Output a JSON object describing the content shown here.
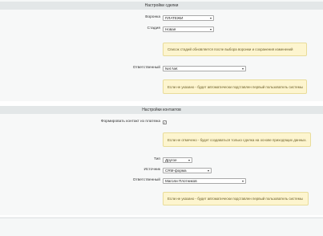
{
  "deal_settings": {
    "title": "Настройки сделки",
    "funnel": {
      "label": "Воронка",
      "value": "ПЛАТЕЖИ"
    },
    "stage": {
      "label": "Стадия",
      "value": "Новая"
    },
    "stage_hint": "Список стадий обновляется после выбора воронки и сохранения изменений",
    "responsible": {
      "label": "Ответственный",
      "value": "Net Net"
    },
    "responsible_hint": "Если не указано - будет автоматически подставлен первый пользователь системы"
  },
  "contact_settings": {
    "title": "Настройки контактов",
    "create_contact": {
      "label": "Формировать контакт из платежа",
      "checked": true,
      "checkmark": "✓"
    },
    "create_contact_hint": "Если не отмечено - будет создаваться только сделка на основе приходящих данных.",
    "type": {
      "label": "Тип",
      "value": "Другое"
    },
    "source": {
      "label": "Источник",
      "value": "CRM-форма"
    },
    "responsible": {
      "label": "Ответственный",
      "value": "Маголи Плотников"
    },
    "responsible_hint": "Если не указано - будет автоматически подставлен первый пользователь системы"
  },
  "icons": {
    "dropdown": "chevron-down-icon",
    "dropdown_glyph": "▾"
  }
}
